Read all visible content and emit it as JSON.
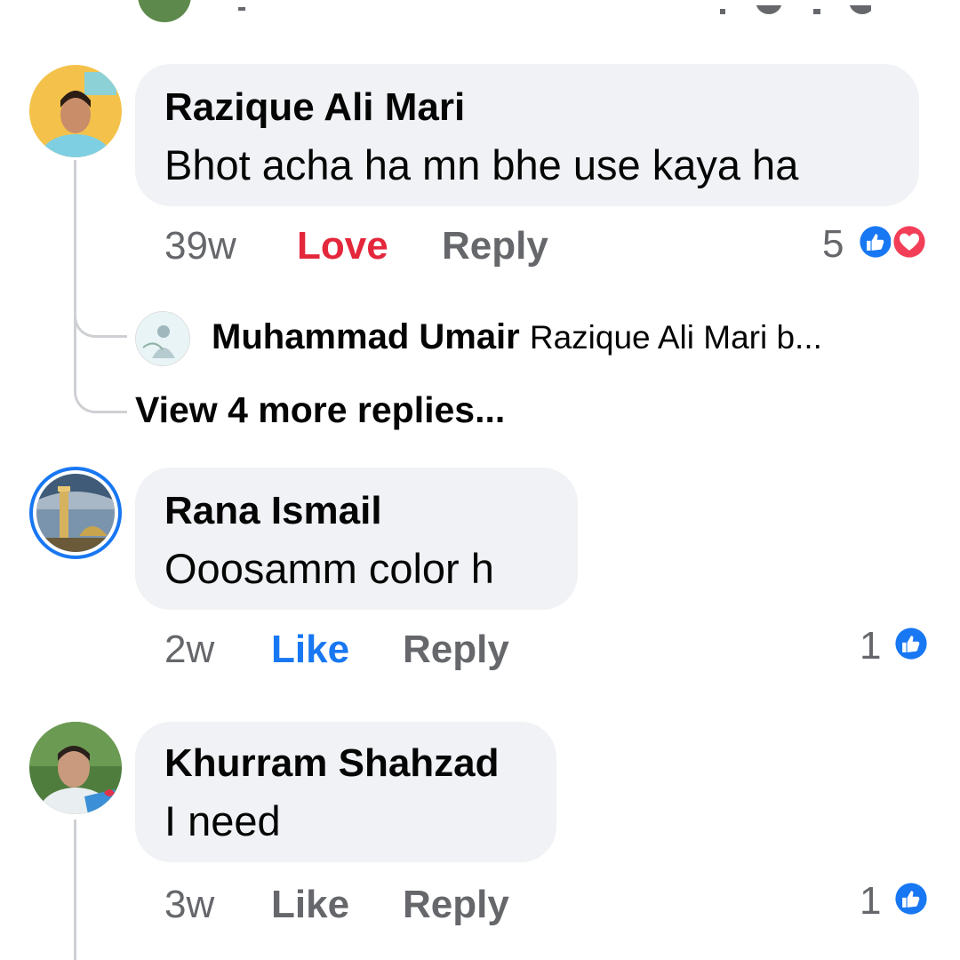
{
  "colors": {
    "like_blue": "#1877f2",
    "love_red": "#e4273b",
    "meta_gray": "#65676b",
    "bubble_bg": "#f0f2f5"
  },
  "comments": [
    {
      "author": "Razique Ali Mari",
      "text": "Bhot acha ha mn bhe use kaya ha",
      "time": "39w",
      "reaction_label": "Love",
      "reply_label": "Reply",
      "reaction_count": "5",
      "reaction_icons": [
        "like-icon",
        "love-icon"
      ],
      "replies": [
        {
          "author": "Muhammad Umair",
          "text": "Razique Ali Mari b..."
        }
      ],
      "view_more": "View 4 more replies..."
    },
    {
      "author": "Rana Ismail",
      "text": "Ooosamm color h",
      "time": "2w",
      "reaction_label": "Like",
      "reply_label": "Reply",
      "reaction_count": "1",
      "reaction_icons": [
        "like-icon"
      ]
    },
    {
      "author": "Khurram Shahzad",
      "text": "I need",
      "time": "3w",
      "reaction_label": "Like",
      "reply_label": "Reply",
      "reaction_count": "1",
      "reaction_icons": [
        "like-icon"
      ]
    }
  ]
}
